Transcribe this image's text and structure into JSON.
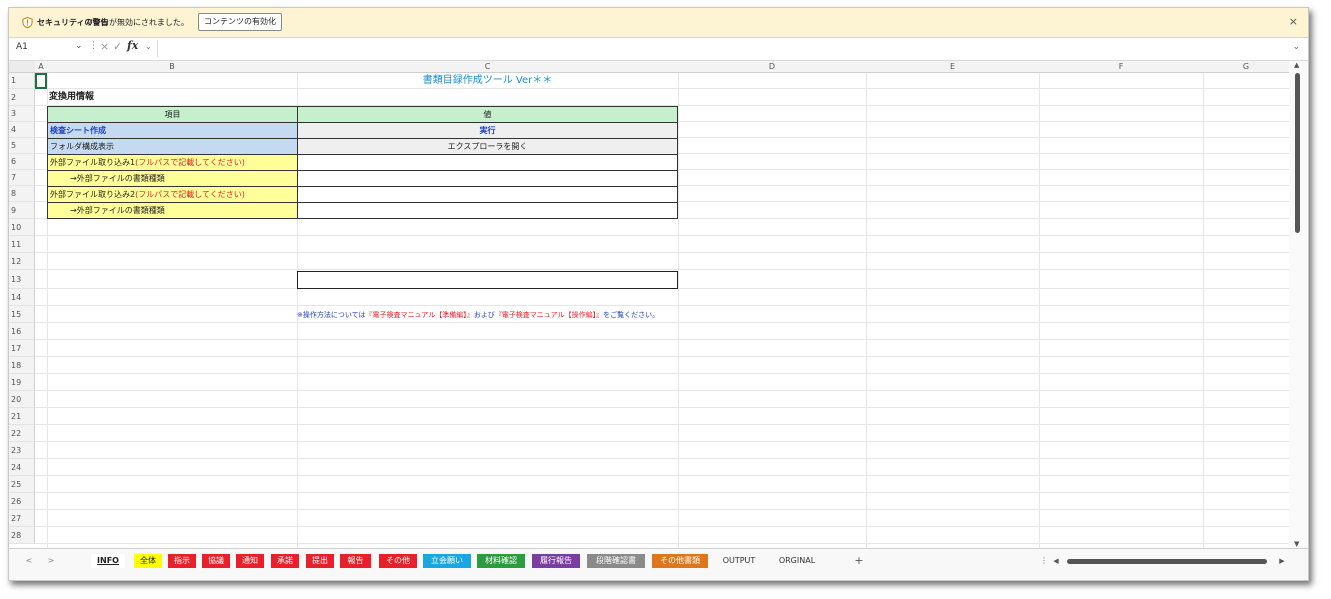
{
  "security_bar": {
    "title": "セキュリティの警告",
    "message": "マクロが無効にされました。",
    "enable_button": "コンテンツの有効化",
    "close": "×"
  },
  "formula_bar": {
    "name_box": "A1",
    "fx": "fx",
    "value": ""
  },
  "columns": [
    "A",
    "B",
    "C",
    "D",
    "E",
    "F",
    "G"
  ],
  "rows": [
    "1",
    "2",
    "3",
    "4",
    "5",
    "6",
    "7",
    "8",
    "9",
    "10",
    "11",
    "12",
    "13",
    "14",
    "15",
    "16",
    "17",
    "18",
    "19",
    "20",
    "21",
    "22",
    "23",
    "24",
    "25",
    "26",
    "27",
    "28"
  ],
  "sheet": {
    "title": "書類目録作成ツール Ver＊＊",
    "section_label": "変換用情報",
    "table_header_item": "項目",
    "table_header_value": "値",
    "row4_item": "検査シート作成",
    "row4_value": "実行",
    "row5_item": "フォルダ構成表示",
    "row5_value": "エクスプローラを開く",
    "row6_item_a": "外部ファイル取り込み1",
    "row6_item_b": "(フルパスで記載してください)",
    "row7_item": "→外部ファイルの書類種類",
    "row8_item_a": "外部ファイル取り込み2",
    "row8_item_b": "(フルパスで記載してください)",
    "row9_item": "→外部ファイルの書類種類",
    "note_a": "※操作方法については",
    "note_b": "『電子検査マニュアル【準備編】』",
    "note_c": "および",
    "note_d": "『電子検査マニュアル【操作編】』",
    "note_e": "をご覧ください。"
  },
  "tabs": [
    {
      "label": "INFO",
      "bg": "#ffffff",
      "fg": "#222222"
    },
    {
      "label": "全体",
      "bg": "#ffff00",
      "fg": "#222222"
    },
    {
      "label": "指示",
      "bg": "#e8202a",
      "fg": "#ffffff"
    },
    {
      "label": "協議",
      "bg": "#e8202a",
      "fg": "#ffffff"
    },
    {
      "label": "通知",
      "bg": "#e8202a",
      "fg": "#ffffff"
    },
    {
      "label": "承諾",
      "bg": "#e8202a",
      "fg": "#ffffff"
    },
    {
      "label": "提出",
      "bg": "#e8202a",
      "fg": "#ffffff"
    },
    {
      "label": "報告",
      "bg": "#e8202a",
      "fg": "#ffffff"
    },
    {
      "label": "その他",
      "bg": "#e8202a",
      "fg": "#ffffff"
    },
    {
      "label": "立会願い",
      "bg": "#1aa6e0",
      "fg": "#ffffff"
    },
    {
      "label": "材料確認",
      "bg": "#2e9b3e",
      "fg": "#ffffff"
    },
    {
      "label": "履行報告",
      "bg": "#7a3ea0",
      "fg": "#ffffff"
    },
    {
      "label": "段階確認書",
      "bg": "#8a8a8a",
      "fg": "#ffffff"
    },
    {
      "label": "その他書類",
      "bg": "#e0761a",
      "fg": "#ffffff"
    },
    {
      "label": "OUTPUT",
      "bg": "transparent",
      "fg": "#333333"
    },
    {
      "label": "ORGINAL",
      "bg": "transparent",
      "fg": "#333333"
    }
  ],
  "tab_nav": {
    "prev": "<",
    "next": ">",
    "add": "+"
  },
  "colors": {
    "header_green": "#c6efce",
    "header_blue": "#c5d9f1",
    "header_yellow": "#ffff99",
    "title_blue": "#1a8fd6"
  }
}
